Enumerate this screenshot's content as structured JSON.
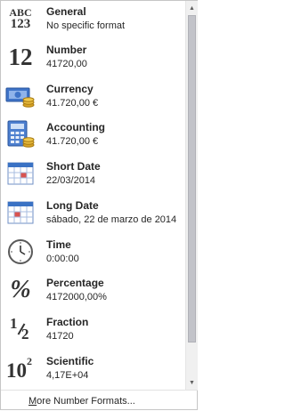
{
  "formats": [
    {
      "name": "General",
      "example": "No specific format",
      "icon": "general-abc123-icon"
    },
    {
      "name": "Number",
      "example": "41720,00",
      "icon": "number-12-icon"
    },
    {
      "name": "Currency",
      "example": "41.720,00 €",
      "icon": "currency-icon"
    },
    {
      "name": "Accounting",
      "example": " 41.720,00 €",
      "icon": "accounting-icon"
    },
    {
      "name": "Short Date",
      "example": "22/03/2014",
      "icon": "calendar-icon"
    },
    {
      "name": "Long Date",
      "example": "sábado, 22 de marzo de 2014",
      "icon": "calendar-icon"
    },
    {
      "name": "Time",
      "example": "0:00:00",
      "icon": "clock-icon"
    },
    {
      "name": "Percentage",
      "example": "4172000,00%",
      "icon": "percent-icon"
    },
    {
      "name": "Fraction",
      "example": "41720",
      "icon": "fraction-icon"
    },
    {
      "name": "Scientific",
      "example": "4,17E+04",
      "icon": "scientific-icon"
    }
  ],
  "icon_text": {
    "general_top": "ABC",
    "general_bottom": "123",
    "number": "12",
    "percent": "%",
    "fraction_num": "1",
    "fraction_den": "2",
    "sci_base": "10",
    "sci_exp": "2"
  },
  "footer": {
    "more_label": "More Number Formats..."
  },
  "scrollbar": {
    "up_arrow": "▲",
    "down_arrow": "▼"
  },
  "colors": {
    "calendar_header": "#3a72c4",
    "money_green": "#5a8a2a",
    "coin_gold": "#d9a527"
  }
}
